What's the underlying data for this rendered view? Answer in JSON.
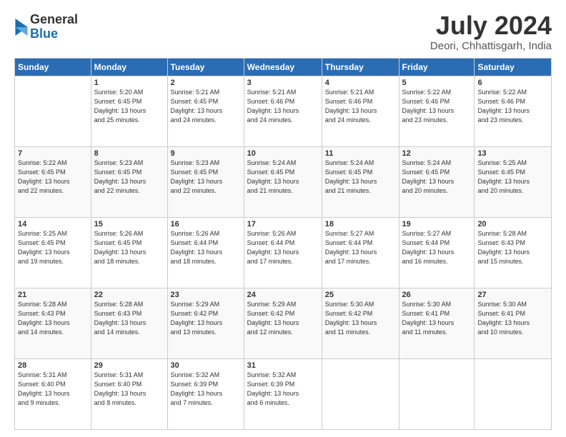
{
  "logo": {
    "general": "General",
    "blue": "Blue"
  },
  "title": "July 2024",
  "location": "Deori, Chhattisgarh, India",
  "days_of_week": [
    "Sunday",
    "Monday",
    "Tuesday",
    "Wednesday",
    "Thursday",
    "Friday",
    "Saturday"
  ],
  "weeks": [
    [
      {
        "day": "",
        "info": ""
      },
      {
        "day": "1",
        "info": "Sunrise: 5:20 AM\nSunset: 6:45 PM\nDaylight: 13 hours\nand 25 minutes."
      },
      {
        "day": "2",
        "info": "Sunrise: 5:21 AM\nSunset: 6:45 PM\nDaylight: 13 hours\nand 24 minutes."
      },
      {
        "day": "3",
        "info": "Sunrise: 5:21 AM\nSunset: 6:46 PM\nDaylight: 13 hours\nand 24 minutes."
      },
      {
        "day": "4",
        "info": "Sunrise: 5:21 AM\nSunset: 6:46 PM\nDaylight: 13 hours\nand 24 minutes."
      },
      {
        "day": "5",
        "info": "Sunrise: 5:22 AM\nSunset: 6:46 PM\nDaylight: 13 hours\nand 23 minutes."
      },
      {
        "day": "6",
        "info": "Sunrise: 5:22 AM\nSunset: 6:46 PM\nDaylight: 13 hours\nand 23 minutes."
      }
    ],
    [
      {
        "day": "7",
        "info": "Sunrise: 5:22 AM\nSunset: 6:45 PM\nDaylight: 13 hours\nand 22 minutes."
      },
      {
        "day": "8",
        "info": "Sunrise: 5:23 AM\nSunset: 6:45 PM\nDaylight: 13 hours\nand 22 minutes."
      },
      {
        "day": "9",
        "info": "Sunrise: 5:23 AM\nSunset: 6:45 PM\nDaylight: 13 hours\nand 22 minutes."
      },
      {
        "day": "10",
        "info": "Sunrise: 5:24 AM\nSunset: 6:45 PM\nDaylight: 13 hours\nand 21 minutes."
      },
      {
        "day": "11",
        "info": "Sunrise: 5:24 AM\nSunset: 6:45 PM\nDaylight: 13 hours\nand 21 minutes."
      },
      {
        "day": "12",
        "info": "Sunrise: 5:24 AM\nSunset: 6:45 PM\nDaylight: 13 hours\nand 20 minutes."
      },
      {
        "day": "13",
        "info": "Sunrise: 5:25 AM\nSunset: 6:45 PM\nDaylight: 13 hours\nand 20 minutes."
      }
    ],
    [
      {
        "day": "14",
        "info": "Sunrise: 5:25 AM\nSunset: 6:45 PM\nDaylight: 13 hours\nand 19 minutes."
      },
      {
        "day": "15",
        "info": "Sunrise: 5:26 AM\nSunset: 6:45 PM\nDaylight: 13 hours\nand 18 minutes."
      },
      {
        "day": "16",
        "info": "Sunrise: 5:26 AM\nSunset: 6:44 PM\nDaylight: 13 hours\nand 18 minutes."
      },
      {
        "day": "17",
        "info": "Sunrise: 5:26 AM\nSunset: 6:44 PM\nDaylight: 13 hours\nand 17 minutes."
      },
      {
        "day": "18",
        "info": "Sunrise: 5:27 AM\nSunset: 6:44 PM\nDaylight: 13 hours\nand 17 minutes."
      },
      {
        "day": "19",
        "info": "Sunrise: 5:27 AM\nSunset: 6:44 PM\nDaylight: 13 hours\nand 16 minutes."
      },
      {
        "day": "20",
        "info": "Sunrise: 5:28 AM\nSunset: 6:43 PM\nDaylight: 13 hours\nand 15 minutes."
      }
    ],
    [
      {
        "day": "21",
        "info": "Sunrise: 5:28 AM\nSunset: 6:43 PM\nDaylight: 13 hours\nand 14 minutes."
      },
      {
        "day": "22",
        "info": "Sunrise: 5:28 AM\nSunset: 6:43 PM\nDaylight: 13 hours\nand 14 minutes."
      },
      {
        "day": "23",
        "info": "Sunrise: 5:29 AM\nSunset: 6:42 PM\nDaylight: 13 hours\nand 13 minutes."
      },
      {
        "day": "24",
        "info": "Sunrise: 5:29 AM\nSunset: 6:42 PM\nDaylight: 13 hours\nand 12 minutes."
      },
      {
        "day": "25",
        "info": "Sunrise: 5:30 AM\nSunset: 6:42 PM\nDaylight: 13 hours\nand 11 minutes."
      },
      {
        "day": "26",
        "info": "Sunrise: 5:30 AM\nSunset: 6:41 PM\nDaylight: 13 hours\nand 11 minutes."
      },
      {
        "day": "27",
        "info": "Sunrise: 5:30 AM\nSunset: 6:41 PM\nDaylight: 13 hours\nand 10 minutes."
      }
    ],
    [
      {
        "day": "28",
        "info": "Sunrise: 5:31 AM\nSunset: 6:40 PM\nDaylight: 13 hours\nand 9 minutes."
      },
      {
        "day": "29",
        "info": "Sunrise: 5:31 AM\nSunset: 6:40 PM\nDaylight: 13 hours\nand 8 minutes."
      },
      {
        "day": "30",
        "info": "Sunrise: 5:32 AM\nSunset: 6:39 PM\nDaylight: 13 hours\nand 7 minutes."
      },
      {
        "day": "31",
        "info": "Sunrise: 5:32 AM\nSunset: 6:39 PM\nDaylight: 13 hours\nand 6 minutes."
      },
      {
        "day": "",
        "info": ""
      },
      {
        "day": "",
        "info": ""
      },
      {
        "day": "",
        "info": ""
      }
    ]
  ]
}
